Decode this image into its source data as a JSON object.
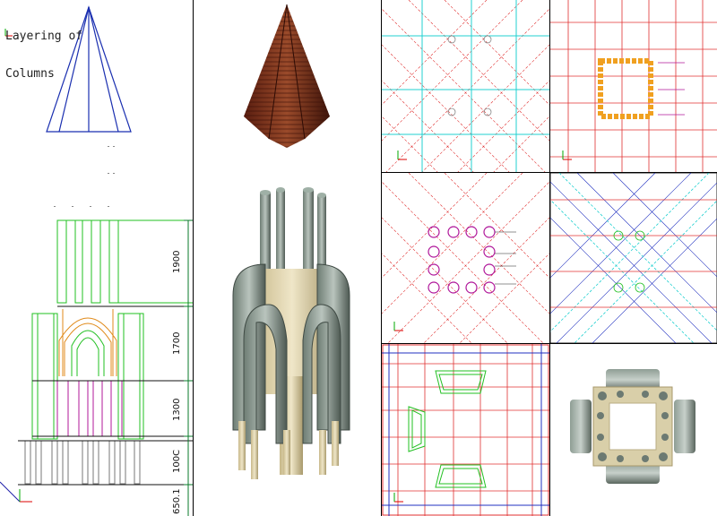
{
  "drawing": {
    "title_line1": "Layering of",
    "title_line2": "Columns",
    "dimensions": [
      "1900",
      "1700",
      "1300",
      "100C",
      "650.1"
    ],
    "icons": [
      "axis-icon"
    ]
  }
}
